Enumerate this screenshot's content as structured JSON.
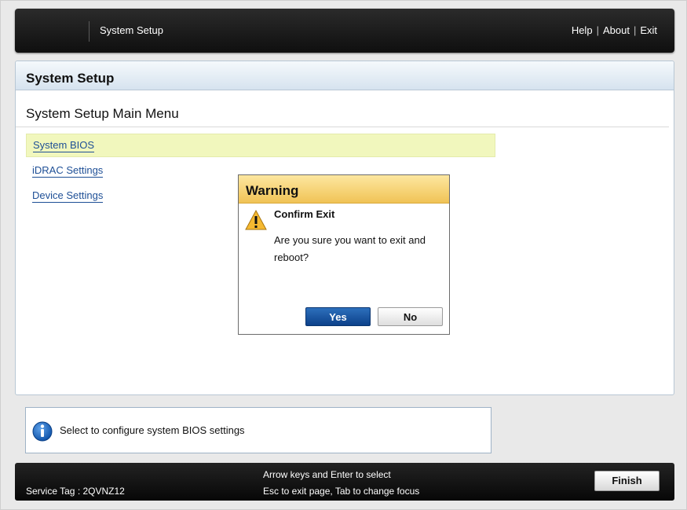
{
  "header": {
    "app_title": "System Setup",
    "links": [
      "Help",
      "About",
      "Exit"
    ],
    "separator": "|"
  },
  "panel": {
    "title": "System Setup",
    "page_heading": "System Setup Main Menu",
    "menu_items": [
      {
        "label": "System BIOS",
        "selected": true
      },
      {
        "label": "iDRAC Settings",
        "selected": false
      },
      {
        "label": "Device Settings",
        "selected": false
      }
    ]
  },
  "dialog": {
    "title": "Warning",
    "icon": "warning-icon",
    "heading": "Confirm Exit",
    "message": "Are you sure you want to exit and reboot?",
    "yes_label": "Yes",
    "no_label": "No"
  },
  "info": {
    "icon": "info-icon",
    "text": "Select to configure system BIOS settings"
  },
  "footer": {
    "service_tag": "Service Tag : 2QVNZ12",
    "hint_line1": "Arrow keys and Enter to select",
    "hint_line2": "Esc to exit page, Tab to change focus",
    "finish_label": "Finish"
  },
  "colors": {
    "selected_row": "#f1f7bd",
    "link": "#1e4f96",
    "yes_button": "#0c418a",
    "dialog_header": "#f0c356",
    "bar": "#111111"
  }
}
